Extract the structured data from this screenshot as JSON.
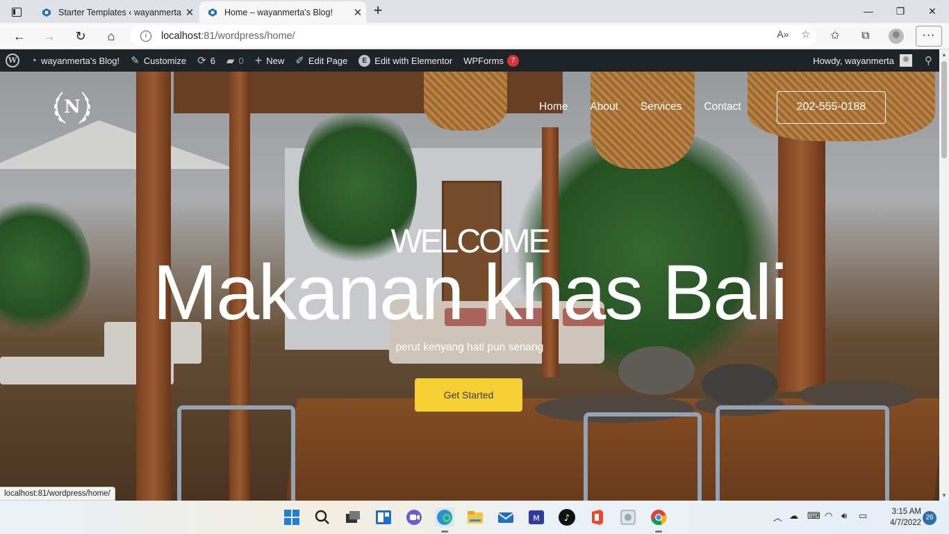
{
  "browser": {
    "tabs": [
      {
        "title": "Starter Templates ‹ wayanmerta's",
        "active": false
      },
      {
        "title": "Home – wayanmerta's Blog!",
        "active": true
      }
    ],
    "new_tab": "+",
    "window_controls": {
      "minimize": "—",
      "maximize": "❐",
      "close": "✕"
    },
    "address": {
      "host": "localhost",
      "path": ":81/wordpress/home/"
    },
    "nav_icons": [
      "back-icon",
      "forward-icon",
      "refresh-icon",
      "home-icon"
    ],
    "toolbar_icons": [
      "read-aloud-icon",
      "add-favorite-icon",
      "favorites-icon",
      "collections-icon",
      "profile-icon",
      "more-icon"
    ],
    "status_url": "localhost:81/wordpress/home/"
  },
  "admin_bar": {
    "site_name": "wayanmerta's Blog!",
    "customize": "Customize",
    "updates_count": "6",
    "comments_count": "0",
    "new": "New",
    "edit_page": "Edit Page",
    "elementor": "Edit with Elementor",
    "wpforms": "WPForms",
    "wpforms_badge": "7",
    "howdy": "Howdy, wayanmerta"
  },
  "site": {
    "logo_letter": "N",
    "nav": [
      "Home",
      "About",
      "Services",
      "Contact"
    ],
    "phone": "202-555-0188",
    "welcome": "WELCOME",
    "headline": "Makanan khas Bali",
    "tagline": "perut kenyang hati pun senang",
    "cta": "Get Started"
  },
  "taskbar": {
    "apps": [
      "windows-start-icon",
      "search-icon",
      "task-view-icon",
      "widgets-icon",
      "chat-icon",
      "edge-icon",
      "file-explorer-icon",
      "mail-icon",
      "vpn-icon",
      "tiktok-icon",
      "office-icon",
      "scanner-icon",
      "chrome-icon"
    ],
    "time": "3:15 AM",
    "date": "4/7/2022",
    "notification_count": "26"
  },
  "colors": {
    "admin_bar_bg": "#1d2327",
    "cta_bg": "#f5cf34",
    "badge": "#d63638"
  }
}
